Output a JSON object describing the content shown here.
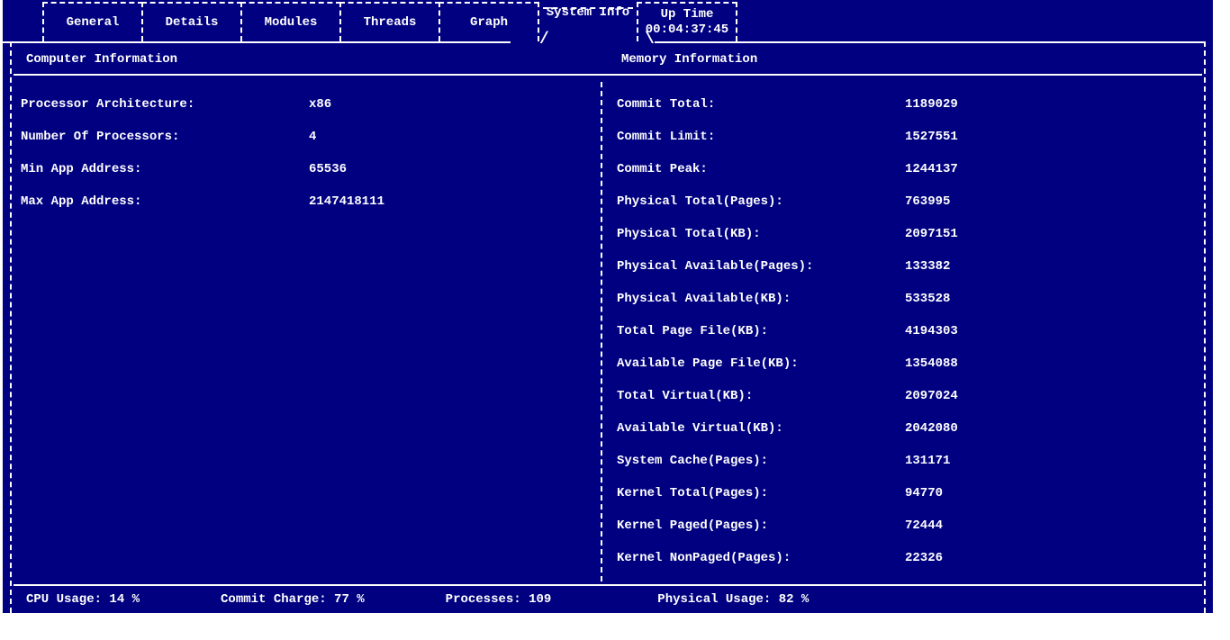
{
  "tabs": {
    "general": "General",
    "details": "Details",
    "modules": "Modules",
    "threads": "Threads",
    "graph": "Graph",
    "system_info": "System Info",
    "uptime_label": "Up Time",
    "uptime_value": "00:04:37:45"
  },
  "sections": {
    "computer": "Computer Information",
    "memory": "Memory Information"
  },
  "computer": {
    "arch_label": "Processor Architecture:",
    "arch_value": "x86",
    "nproc_label": "Number Of Processors:",
    "nproc_value": "4",
    "minaddr_label": "Min App Address:",
    "minaddr_value": "65536",
    "maxaddr_label": "Max App Address:",
    "maxaddr_value": "2147418111"
  },
  "memory": {
    "commit_total_label": "Commit Total:",
    "commit_total_value": "1189029",
    "commit_limit_label": "Commit Limit:",
    "commit_limit_value": "1527551",
    "commit_peak_label": "Commit Peak:",
    "commit_peak_value": "1244137",
    "phys_total_pages_label": "Physical Total(Pages):",
    "phys_total_pages_value": "763995",
    "phys_total_kb_label": "Physical Total(KB):",
    "phys_total_kb_value": "2097151",
    "phys_avail_pages_label": "Physical Available(Pages):",
    "phys_avail_pages_value": "133382",
    "phys_avail_kb_label": "Physical Available(KB):",
    "phys_avail_kb_value": "533528",
    "total_pagefile_label": "Total Page File(KB):",
    "total_pagefile_value": "4194303",
    "avail_pagefile_label": "Available Page File(KB):",
    "avail_pagefile_value": "1354088",
    "total_virtual_label": "Total Virtual(KB):",
    "total_virtual_value": "2097024",
    "avail_virtual_label": "Available Virtual(KB):",
    "avail_virtual_value": "2042080",
    "syscache_label": "System Cache(Pages):",
    "syscache_value": "131171",
    "kernel_total_label": "Kernel Total(Pages):",
    "kernel_total_value": "94770",
    "kernel_paged_label": "Kernel Paged(Pages):",
    "kernel_paged_value": "72444",
    "kernel_nonpaged_label": "Kernel NonPaged(Pages):",
    "kernel_nonpaged_value": "22326"
  },
  "status": {
    "cpu": "CPU Usage: 14 %",
    "commit": "Commit Charge: 77 %",
    "processes": "Processes: 109",
    "physical": "Physical Usage: 82 %"
  }
}
